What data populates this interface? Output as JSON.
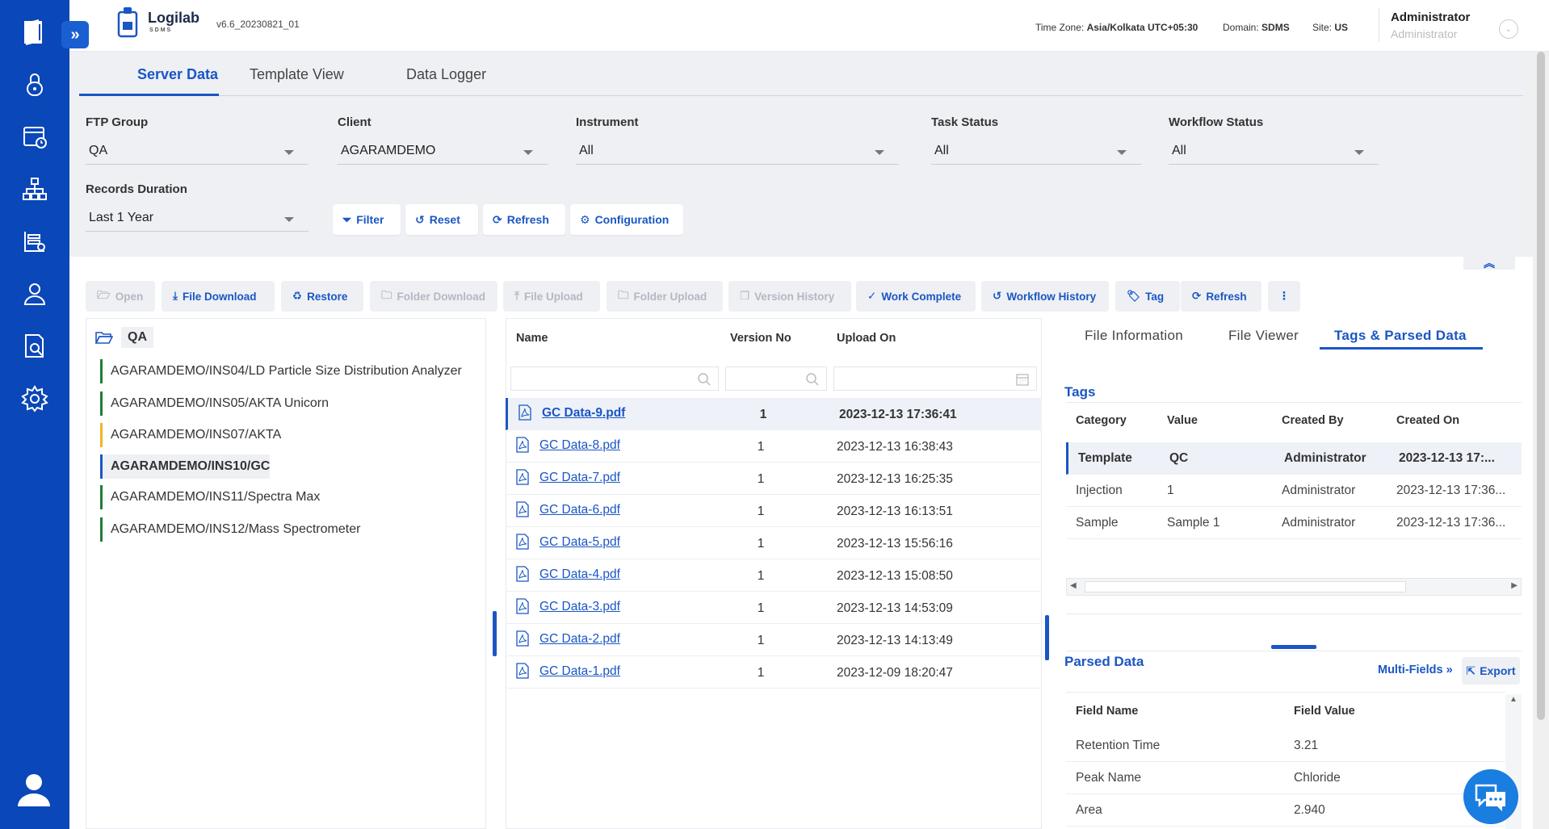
{
  "app": {
    "brand_name": "Logilab",
    "brand_sub": "SDMS",
    "version": "v6.6_20230821_01"
  },
  "header": {
    "timezone_label": "Time Zone:",
    "timezone_value": "Asia/Kolkata UTC+05:30",
    "domain_label": "Domain:",
    "domain_value": "SDMS",
    "site_label": "Site:",
    "site_value": "US",
    "user_name": "Administrator",
    "user_role": "Administrator"
  },
  "tabs": [
    {
      "label": "Server Data",
      "active": true
    },
    {
      "label": "Template View",
      "active": false
    },
    {
      "label": "Data Logger",
      "active": false
    }
  ],
  "filters": {
    "ftp_group": {
      "label": "FTP Group",
      "value": "QA"
    },
    "client": {
      "label": "Client",
      "value": "AGARAMDEMO"
    },
    "instrument": {
      "label": "Instrument",
      "value": "All"
    },
    "task_status": {
      "label": "Task Status",
      "value": "All"
    },
    "workflow_status": {
      "label": "Workflow Status",
      "value": "All"
    },
    "records_duration": {
      "label": "Records Duration",
      "value": "Last 1 Year"
    }
  },
  "filter_buttons": {
    "filter": "Filter",
    "reset": "Reset",
    "refresh": "Refresh",
    "configuration": "Configuration"
  },
  "toolbar": {
    "open": "Open",
    "file_download": "File Download",
    "restore": "Restore",
    "folder_download": "Folder Download",
    "file_upload": "File Upload",
    "folder_upload": "Folder Upload",
    "version_history": "Version History",
    "work_complete": "Work Complete",
    "workflow_history": "Workflow History",
    "tag": "Tag",
    "refresh": "Refresh"
  },
  "tree": {
    "root": "QA",
    "items": [
      {
        "label": "AGARAMDEMO/INS04/LD Particle Size Distribution Analyzer",
        "color": "#1e7e34",
        "selected": false
      },
      {
        "label": "AGARAMDEMO/INS05/AKTA Unicorn",
        "color": "#1e7e34",
        "selected": false
      },
      {
        "label": "AGARAMDEMO/INS07/AKTA",
        "color": "#f0b429",
        "selected": false
      },
      {
        "label": "AGARAMDEMO/INS10/GC",
        "color": "#1a56c4",
        "selected": true
      },
      {
        "label": "AGARAMDEMO/INS11/Spectra Max",
        "color": "#1e7e34",
        "selected": false
      },
      {
        "label": "AGARAMDEMO/INS12/Mass Spectrometer",
        "color": "#1e7e34",
        "selected": false
      }
    ]
  },
  "files": {
    "columns": {
      "name": "Name",
      "version": "Version No",
      "upload": "Upload On"
    },
    "rows": [
      {
        "name": "GC Data-9.pdf",
        "version": "1",
        "upload": "2023-12-13 17:36:41",
        "selected": true
      },
      {
        "name": "GC Data-8.pdf",
        "version": "1",
        "upload": "2023-12-13 16:38:43",
        "selected": false
      },
      {
        "name": "GC Data-7.pdf",
        "version": "1",
        "upload": "2023-12-13 16:25:35",
        "selected": false
      },
      {
        "name": "GC Data-6.pdf",
        "version": "1",
        "upload": "2023-12-13 16:13:51",
        "selected": false
      },
      {
        "name": "GC Data-5.pdf",
        "version": "1",
        "upload": "2023-12-13 15:56:16",
        "selected": false
      },
      {
        "name": "GC Data-4.pdf",
        "version": "1",
        "upload": "2023-12-13 15:08:50",
        "selected": false
      },
      {
        "name": "GC Data-3.pdf",
        "version": "1",
        "upload": "2023-12-13 14:53:09",
        "selected": false
      },
      {
        "name": "GC Data-2.pdf",
        "version": "1",
        "upload": "2023-12-13 14:13:49",
        "selected": false
      },
      {
        "name": "GC Data-1.pdf",
        "version": "1",
        "upload": "2023-12-09 18:20:47",
        "selected": false
      }
    ]
  },
  "right_tabs": [
    {
      "label": "File Information",
      "active": false
    },
    {
      "label": "File Viewer",
      "active": false
    },
    {
      "label": "Tags & Parsed Data",
      "active": true
    }
  ],
  "tags": {
    "title": "Tags",
    "columns": {
      "category": "Category",
      "value": "Value",
      "created_by": "Created By",
      "created_on": "Created On"
    },
    "rows": [
      {
        "category": "Template",
        "value": "QC",
        "created_by": "Administrator",
        "created_on": "2023-12-13 17:...",
        "selected": true
      },
      {
        "category": "Injection",
        "value": "1",
        "created_by": "Administrator",
        "created_on": "2023-12-13 17:36...",
        "selected": false
      },
      {
        "category": "Sample",
        "value": "Sample 1",
        "created_by": "Administrator",
        "created_on": "2023-12-13 17:36...",
        "selected": false
      }
    ]
  },
  "parsed": {
    "title": "Parsed Data",
    "multi_fields": "Multi-Fields",
    "export": "Export",
    "columns": {
      "field_name": "Field Name",
      "field_value": "Field Value"
    },
    "rows": [
      {
        "field_name": "Retention Time",
        "field_value": "3.21"
      },
      {
        "field_name": "Peak Name",
        "field_value": "Chloride"
      },
      {
        "field_name": "Area",
        "field_value": "2.940"
      }
    ]
  },
  "colors": {
    "rail": "#0a47b8",
    "accent": "#1a56c4",
    "panel_bg": "#eef0f4"
  }
}
